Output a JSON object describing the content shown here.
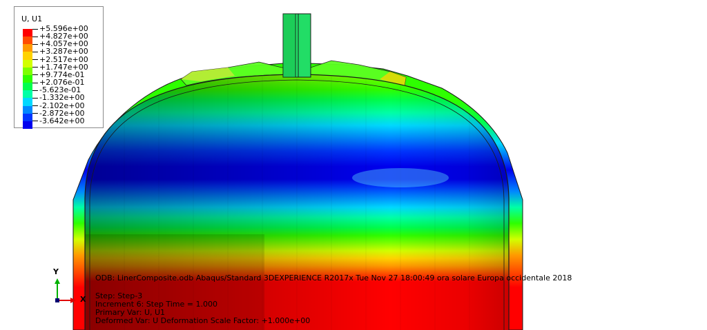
{
  "legend": {
    "title": "U, U1",
    "colors": [
      "#ff0000",
      "#ff4c00",
      "#ff9900",
      "#ffd200",
      "#d2ff00",
      "#7dff00",
      "#2eff00",
      "#00ff4c",
      "#00ffa6",
      "#00d8ff",
      "#0087ff",
      "#0036ff",
      "#0000ee"
    ],
    "labels": [
      "+5.596e+00",
      "+4.827e+00",
      "+4.057e+00",
      "+3.287e+00",
      "+2.517e+00",
      "+1.747e+00",
      "+9.774e-01",
      "+2.076e-01",
      "-5.623e-01",
      "-1.332e+00",
      "-2.102e+00",
      "-2.872e+00",
      "-3.642e+00"
    ]
  },
  "info": {
    "odb_line": "ODB: LinerComposite.odb    Abaqus/Standard 3DEXPERIENCE R2017x    Tue Nov 27 18:00:49 ora solare Europa occidentale 2018",
    "step_line": "Step: Step-3",
    "increment_line": "Increment      6: Step Time =    1.000",
    "primary_var_line": "Primary Var: U, U1",
    "deformed_var_line": "Deformed Var: U   Deformation Scale Factor: +1.000e+00"
  },
  "triad": {
    "y_label": "Y",
    "x_label": "X",
    "y_color": "#00b000",
    "x_color": "#e00000"
  }
}
